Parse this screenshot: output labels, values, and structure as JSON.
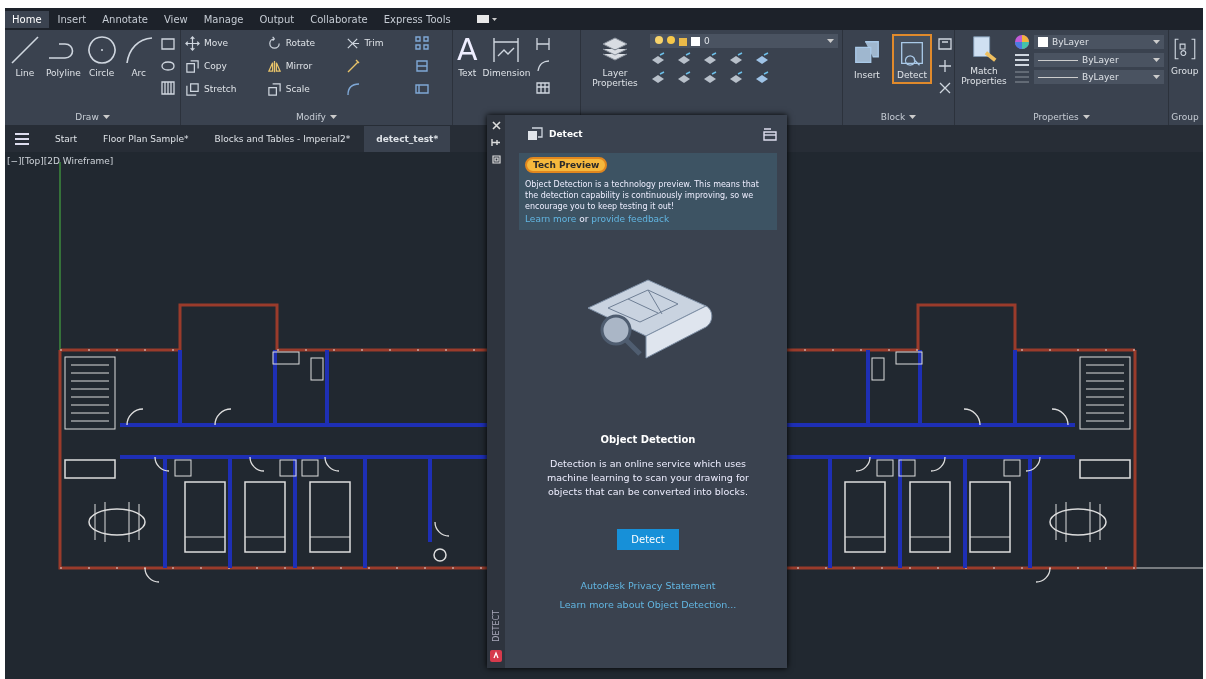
{
  "menu_tabs": [
    {
      "label": "Home",
      "selected": true
    },
    {
      "label": "Insert",
      "selected": false
    },
    {
      "label": "Annotate",
      "selected": false
    },
    {
      "label": "View",
      "selected": false
    },
    {
      "label": "Manage",
      "selected": false
    },
    {
      "label": "Output",
      "selected": false
    },
    {
      "label": "Collaborate",
      "selected": false
    },
    {
      "label": "Express Tools",
      "selected": false
    }
  ],
  "ribbon": {
    "draw": {
      "title": "Draw",
      "tools": [
        "Line",
        "Polyline",
        "Circle",
        "Arc"
      ]
    },
    "modify": {
      "title": "Modify",
      "tools": [
        "Move",
        "Copy",
        "Stretch",
        "Rotate",
        "Mirror",
        "Scale",
        "Trim"
      ]
    },
    "annotation": {
      "text_glyph": "A",
      "tools": [
        "Text",
        "Dimension"
      ]
    },
    "layers": {
      "tools": [
        "Layer Properties"
      ],
      "layer_value": "0"
    },
    "block": {
      "title": "Block",
      "tools": [
        {
          "label": "Insert",
          "selected": false
        },
        {
          "label": "Detect",
          "selected": true
        }
      ]
    },
    "properties": {
      "title": "Properties",
      "tools": [
        "Match Properties"
      ],
      "color_value": "ByLayer",
      "linetype_value": "ByLayer",
      "lineweight_value": "ByLayer"
    },
    "groups": {
      "title": "Group",
      "tools": [
        "Group"
      ]
    }
  },
  "doc_tabs": [
    {
      "label": "Start",
      "selected": false
    },
    {
      "label": "Floor Plan Sample*",
      "selected": false
    },
    {
      "label": "Blocks and Tables - Imperial2*",
      "selected": false
    },
    {
      "label": "detect_test*",
      "selected": true
    }
  ],
  "viewport_label": "[−][Top][2D Wireframe]",
  "palette": {
    "title": "Detect",
    "side_label": "DETECT",
    "badge": "Tech Preview",
    "notice": "Object Detection is a technology preview. This means that the detection capability is continuously improving, so we encourage you to keep testing it out!",
    "notice_links": [
      "Learn more",
      "provide feedback"
    ],
    "notice_joiner": "or",
    "heading": "Object Detection",
    "description": "Detection is an online service which uses machine learning to scan your drawing for objects that can be converted into blocks.",
    "button": "Detect",
    "links": [
      "Autodesk Privacy Statement",
      "Learn more about Object Detection..."
    ]
  }
}
